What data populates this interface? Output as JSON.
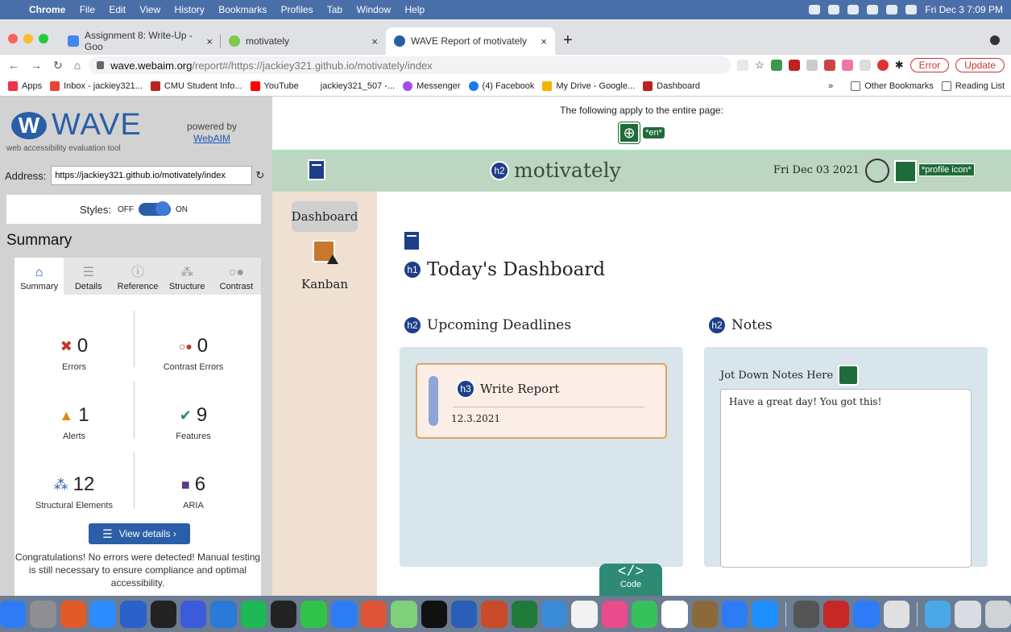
{
  "macbar": {
    "apple": "",
    "menus": [
      "Chrome",
      "File",
      "Edit",
      "View",
      "History",
      "Bookmarks",
      "Profiles",
      "Tab",
      "Window",
      "Help"
    ],
    "clock": "Fri Dec 3  7:09 PM"
  },
  "tabs": [
    {
      "label": "Assignment 8: Write-Up - Goo",
      "close": "×",
      "icon_color": "#4285f4"
    },
    {
      "label": "motivately",
      "close": "×",
      "icon_color": "#7ec84a"
    },
    {
      "label": "WAVE Report of motivately",
      "close": "×",
      "icon_color": "#2a5ea8"
    }
  ],
  "omnibar": {
    "host": "wave.webaim.org",
    "path": "/report#/https://jackiey321.github.io/motivately/index",
    "error_label": "Error",
    "update_label": "Update"
  },
  "bookmarks": {
    "items": [
      "Apps",
      "Inbox - jackiey321...",
      "CMU Student Info...",
      "YouTube",
      "jackiey321_507 -...",
      "Messenger",
      "(4) Facebook",
      "My Drive - Google...",
      "Dashboard"
    ],
    "more": "»",
    "other": "Other Bookmarks",
    "reading": "Reading List"
  },
  "wave": {
    "logo_text": "WAVE",
    "logo_mark": "W",
    "tagline": "web accessibility evaluation tool",
    "powered_by": "powered by",
    "webaim": "WebAIM",
    "address_label": "Address:",
    "address_value": "https://jackiey321.github.io/motivately/index",
    "styles_label": "Styles:",
    "styles_off": "OFF",
    "styles_on": "ON",
    "summary_title": "Summary",
    "tabs": [
      {
        "label": "Summary",
        "glyph": "⌂"
      },
      {
        "label": "Details",
        "glyph": "☰"
      },
      {
        "label": "Reference",
        "glyph": "ⓘ"
      },
      {
        "label": "Structure",
        "glyph": "⁂"
      },
      {
        "label": "Contrast",
        "glyph": "○●"
      }
    ],
    "stats": [
      {
        "count": "0",
        "label": "Errors",
        "color": "#c0392b",
        "glyph": "✖"
      },
      {
        "count": "0",
        "label": "Contrast Errors",
        "color": "#c0392b",
        "glyph": "○●"
      },
      {
        "count": "1",
        "label": "Alerts",
        "color": "#e08a1e",
        "glyph": "▲"
      },
      {
        "count": "9",
        "label": "Features",
        "color": "#2e8b57",
        "glyph": "✔"
      },
      {
        "count": "12",
        "label": "Structural Elements",
        "color": "#2a5ea8",
        "glyph": "⁂"
      },
      {
        "count": "6",
        "label": "ARIA",
        "color": "#5b3a8c",
        "glyph": "■"
      }
    ],
    "view_details": "View details ›",
    "congrats": "Congratulations! No errors were detected! Manual testing is still necessary to ensure compliance and optimal accessibility."
  },
  "page_note": {
    "message": "The following apply to the entire page:",
    "lang": "*en*"
  },
  "site": {
    "brand": "motivately",
    "h2_badge": "h2",
    "date": "Fri Dec 03 2021",
    "profile_alt": "*profile icon*",
    "nav_dashboard": "Dashboard",
    "nav_kanban": "Kanban",
    "h1_badge": "h1",
    "h1": "Today's Dashboard",
    "deadlines_title": "Upcoming Deadlines",
    "notes_title": "Notes",
    "h3_badge": "h3",
    "card_title": "Write Report",
    "card_date": "12.3.2021",
    "jot_label": "Jot Down Notes Here",
    "note_text": "Have a great day! You got this!"
  },
  "code_button": {
    "glyph": "</>",
    "label": "Code"
  },
  "dock_colors": [
    "#2d7cf6",
    "#8e8e93",
    "#e05a2a",
    "#2d8cff",
    "#2a62c9",
    "#222",
    "#3b5bdb",
    "#2a7ad8",
    "#1db954",
    "#222",
    "#30c34a",
    "#2d7cf6",
    "#e0543a",
    "#7fd07a",
    "#111",
    "#2b5db8",
    "#c94b2a",
    "#1f7a3a",
    "#3a8bd8",
    "#f2f2f2",
    "#e84c8a",
    "#37c15a",
    "#fff",
    "#8a6a3a",
    "#2d7cf6",
    "#1e90ff",
    "#555",
    "#c62828",
    "#2d7cf6",
    "#e0e0e0",
    "#4aa8e8",
    "#d9dde2",
    "#cfd3d6"
  ]
}
